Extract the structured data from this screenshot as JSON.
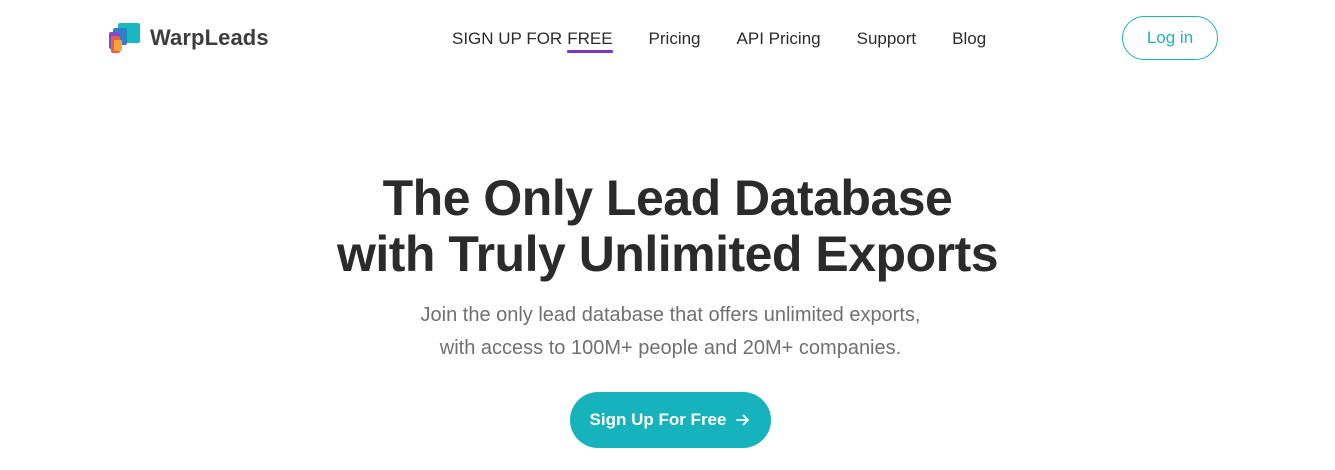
{
  "header": {
    "brand": "WarpLeads",
    "nav": {
      "signup_prefix": "SIGN UP FOR",
      "signup_free": "FREE",
      "pricing": "Pricing",
      "api_pricing": "API Pricing",
      "support": "Support",
      "blog": "Blog"
    },
    "login_label": "Log in"
  },
  "hero": {
    "title_line1": "The Only Lead Database",
    "title_line2": "with Truly Unlimited Exports",
    "subtitle_line1": "Join the only lead database that offers unlimited exports,",
    "subtitle_line2": "with access to 100M+ people and 20M+ companies.",
    "cta_label": "Sign Up For Free",
    "cta_icon": "arrow-right-icon"
  },
  "colors": {
    "accent": "#16b3bd",
    "underline": "#7b35c8",
    "heading": "#2b2b2b",
    "subtext": "#707070"
  }
}
